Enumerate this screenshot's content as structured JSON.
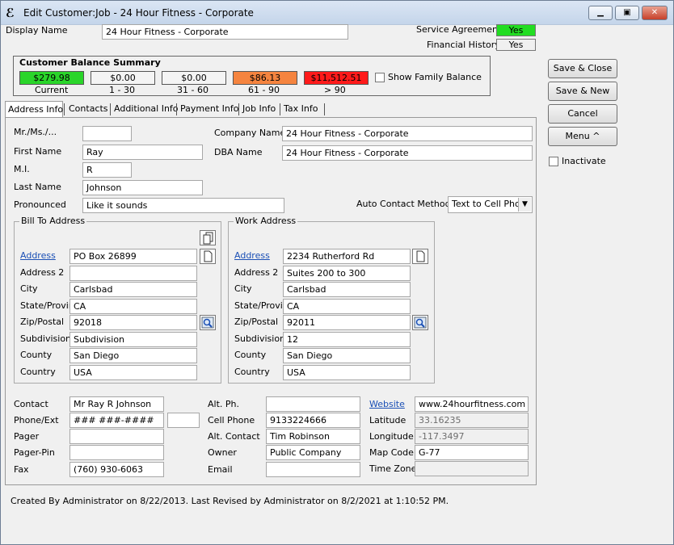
{
  "window": {
    "title": "Edit Customer:Job - 24 Hour Fitness - Corporate"
  },
  "display_name": {
    "label": "Display Name",
    "value": "24 Hour Fitness - Corporate"
  },
  "service_agreement": {
    "label": "Service Agreement",
    "value": "Yes",
    "color": "#22dd22"
  },
  "financial_history": {
    "label": "Financial History",
    "value": "Yes"
  },
  "balance_summary": {
    "title": "Customer Balance Summary",
    "buckets": [
      {
        "amount": "$279.98",
        "label": "Current",
        "color": "#2ad52a"
      },
      {
        "amount": "$0.00",
        "label": "1 - 30",
        "color": "#f4f4f4"
      },
      {
        "amount": "$0.00",
        "label": "31 - 60",
        "color": "#f4f4f4"
      },
      {
        "amount": "$86.13",
        "label": "61 - 90",
        "color": "#f5843f"
      },
      {
        "amount": "$11,512.51",
        "label": "> 90",
        "color": "#ff1a1a"
      }
    ],
    "show_family_label": "Show Family Balance"
  },
  "buttons": {
    "save_close": "Save & Close",
    "save_new": "Save & New",
    "cancel": "Cancel",
    "menu": "Menu ^",
    "inactivate": "Inactivate"
  },
  "tabs": [
    "Address Info",
    "Contacts",
    "Additional Info",
    "Payment Info",
    "Job Info",
    "Tax Info"
  ],
  "form": {
    "mr_label": "Mr./Ms./...",
    "mr_value": "",
    "first_label": "First Name",
    "first_value": "Ray",
    "mi_label": "M.I.",
    "mi_value": "R",
    "last_label": "Last Name",
    "last_value": "Johnson",
    "pron_label": "Pronounced",
    "pron_value": "Like it sounds",
    "company_label": "Company Name",
    "company_value": "24 Hour Fitness - Corporate",
    "dba_label": "DBA Name",
    "dba_value": "24 Hour Fitness - Corporate",
    "auto_contact_label": "Auto Contact Method",
    "auto_contact_value": "Text to Cell Phor"
  },
  "bill_to": {
    "title": "Bill To Address",
    "address_label": "Address",
    "address": "PO Box 26899",
    "address2_label": "Address 2",
    "address2": "",
    "city_label": "City",
    "city": "Carlsbad",
    "state_label": "State/Province",
    "state": "CA",
    "zip_label": "Zip/Postal",
    "zip": "92018",
    "subdivision_label": "Subdivision",
    "subdivision": "Subdivision",
    "county_label": "County",
    "county": "San Diego",
    "country_label": "Country",
    "country": "USA"
  },
  "work": {
    "title": "Work Address",
    "address_label": "Address",
    "address": "2234 Rutherford Rd",
    "address2_label": "Address 2",
    "address2": "Suites 200 to 300",
    "city_label": "City",
    "city": "Carlsbad",
    "state_label": "State/Province",
    "state": "CA",
    "zip_label": "Zip/Postal",
    "zip": "92011",
    "subdivision_label": "Subdivision",
    "subdivision": "12",
    "county_label": "County",
    "county": "San Diego",
    "country_label": "Country",
    "country": "USA"
  },
  "contact": {
    "contact_label": "Contact",
    "contact": "Mr Ray R Johnson",
    "phone_label": "Phone/Ext",
    "phone": "### ###-####",
    "ext": "",
    "pager_label": "Pager",
    "pager": "",
    "pagerpin_label": "Pager-Pin",
    "pagerpin": "",
    "fax_label": "Fax",
    "fax": "(760) 930-6063",
    "altph_label": "Alt. Ph.",
    "altph": "",
    "cell_label": "Cell Phone",
    "cell": "9133224666",
    "altcontact_label": "Alt. Contact",
    "altcontact": "Tim Robinson",
    "owner_label": "Owner",
    "owner": "Public Company",
    "email_label": "Email",
    "email": "",
    "website_label": "Website",
    "website": "www.24hourfitness.com",
    "lat_label": "Latitude",
    "lat": "33.16235",
    "lon_label": "Longitude",
    "lon": "-117.3497",
    "map_label": "Map Code",
    "map": "G-77",
    "tz_label": "Time Zone",
    "tz": ""
  },
  "status": "Created By Administrator on 8/22/2013.  Last Revised by Administrator on 8/2/2021 at 1:10:52 PM."
}
